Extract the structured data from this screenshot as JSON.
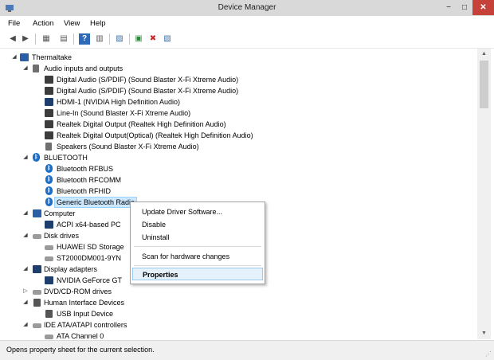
{
  "window": {
    "title": "Device Manager",
    "controls": {
      "minimize": "−",
      "maximize": "□",
      "close": "✕"
    }
  },
  "menu": [
    "File",
    "Action",
    "View",
    "Help"
  ],
  "toolbar": [
    "◀",
    "▶",
    "▦",
    "▤",
    "?",
    "▥",
    "▨",
    "▣",
    "✖",
    "▧"
  ],
  "tree": {
    "root": "Thermaltake",
    "audio": {
      "label": "Audio inputs and outputs",
      "items": [
        "Digital Audio (S/PDIF) (Sound Blaster X-Fi Xtreme Audio)",
        "Digital Audio (S/PDIF) (Sound Blaster X-Fi Xtreme Audio)",
        "HDMI-1 (NVIDIA High Definition Audio)",
        "Line-In (Sound Blaster X-Fi Xtreme Audio)",
        "Realtek Digital Output (Realtek High Definition Audio)",
        "Realtek Digital Output(Optical) (Realtek High Definition Audio)",
        "Speakers (Sound Blaster X-Fi Xtreme Audio)"
      ]
    },
    "bluetooth": {
      "label": "BLUETOOTH",
      "items": [
        "Bluetooth RFBUS",
        "Bluetooth RFCOMM",
        "Bluetooth RFHID",
        "Generic Bluetooth Radio"
      ]
    },
    "computer": {
      "label": "Computer",
      "items": [
        "ACPI x64-based PC"
      ]
    },
    "disk": {
      "label": "Disk drives",
      "items": [
        "HUAWEI SD Storage",
        "ST2000DM001-9YN"
      ]
    },
    "display": {
      "label": "Display adapters",
      "items": [
        "NVIDIA GeForce GT"
      ]
    },
    "dvd": {
      "label": "DVD/CD-ROM drives"
    },
    "hid": {
      "label": "Human Interface Devices",
      "items": [
        "USB Input Device"
      ]
    },
    "ide": {
      "label": "IDE ATA/ATAPI controllers",
      "items": [
        "ATA Channel 0"
      ]
    }
  },
  "context_menu": {
    "update": "Update Driver Software...",
    "disable": "Disable",
    "uninstall": "Uninstall",
    "scan": "Scan for hardware changes",
    "properties": "Properties"
  },
  "status": "Opens property sheet for the current selection.",
  "colors": {
    "accent": "#1b6fc9",
    "selection": "#cce8ff",
    "close": "#c7413b"
  }
}
